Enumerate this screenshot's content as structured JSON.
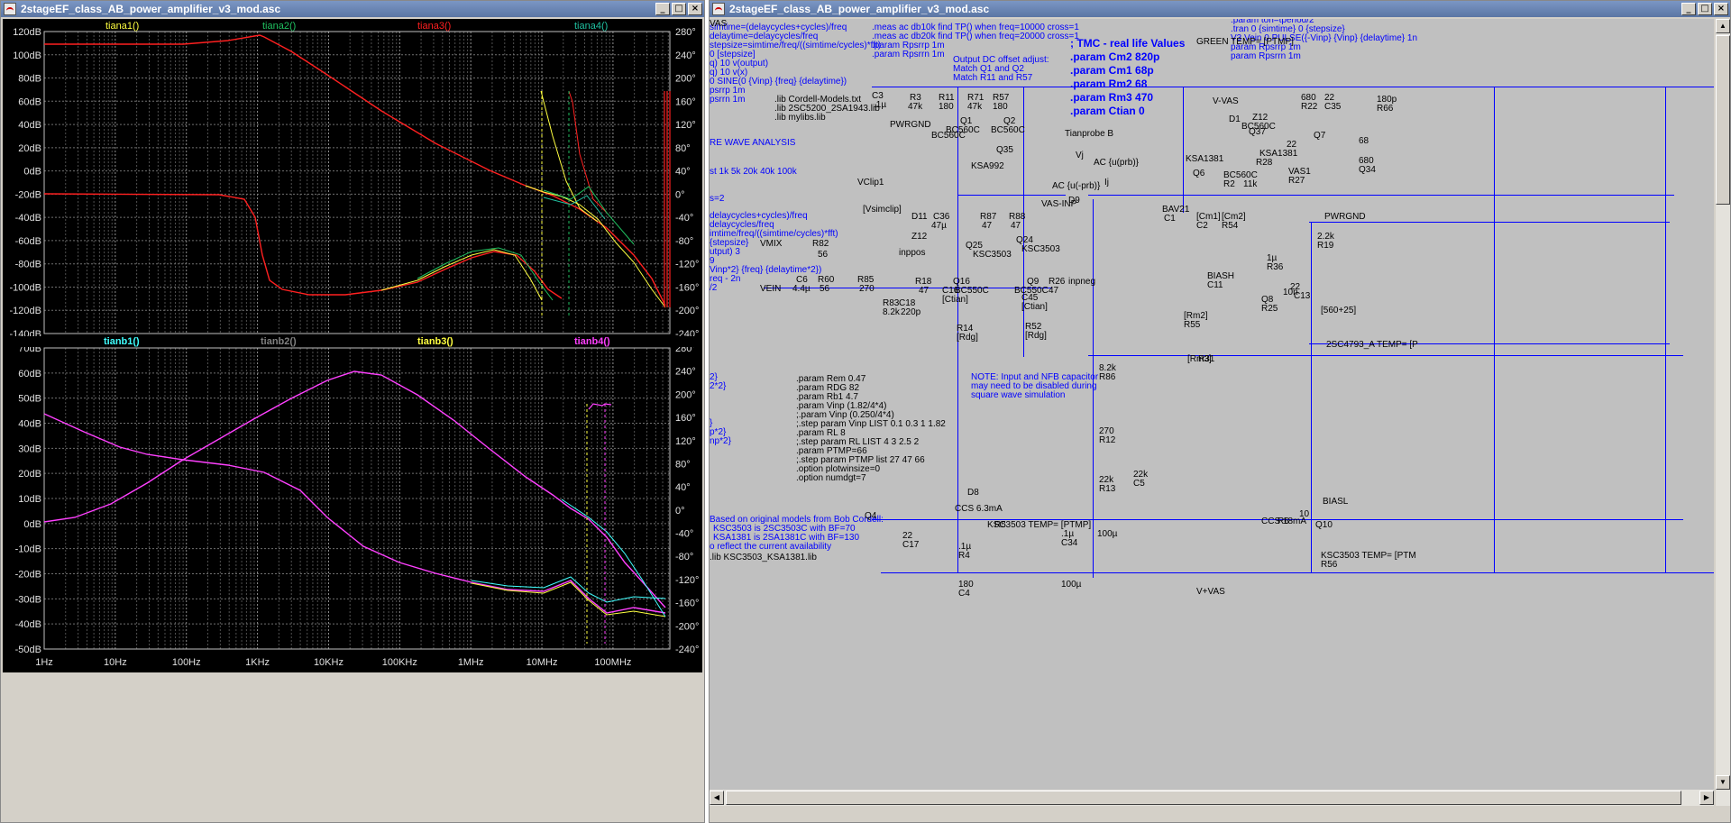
{
  "colors": {
    "grid": "#808080",
    "axis": "#cccccc",
    "red": "#ff2020",
    "magenta": "#ff40ff",
    "cyan": "#40ffff",
    "yellow": "#ffff40",
    "green": "#20c060",
    "wire": "#0000ff"
  },
  "left_window": {
    "title": "2stageEF_class_AB_power_amplifier_v3_mod.asc",
    "top_pane": {
      "traces": [
        {
          "name": "tiana1()",
          "color": "#ffff40"
        },
        {
          "name": "tiana2()",
          "color": "#20c060"
        },
        {
          "name": "tiana3()",
          "color": "#ff2020"
        },
        {
          "name": "tiana4()",
          "color": "#20c0a0"
        }
      ],
      "left_ticks": [
        "120dB",
        "100dB",
        "80dB",
        "60dB",
        "40dB",
        "20dB",
        "0dB",
        "-20dB",
        "-40dB",
        "-60dB",
        "-80dB",
        "-100dB",
        "-120dB",
        "-140dB"
      ],
      "right_ticks": [
        "280°",
        "240°",
        "200°",
        "160°",
        "120°",
        "80°",
        "40°",
        "0°",
        "-40°",
        "-80°",
        "-120°",
        "-160°",
        "-200°",
        "-240°"
      ]
    },
    "bottom_pane": {
      "traces": [
        {
          "name": "tianb1()",
          "color": "#40ffff"
        },
        {
          "name": "tianb2()",
          "color": "#808080"
        },
        {
          "name": "tianb3()",
          "color": "#ffff40"
        },
        {
          "name": "tianb4()",
          "color": "#ff40ff"
        }
      ],
      "left_ticks": [
        "70dB",
        "60dB",
        "50dB",
        "40dB",
        "30dB",
        "20dB",
        "10dB",
        "0dB",
        "-10dB",
        "-20dB",
        "-30dB",
        "-40dB",
        "-50dB"
      ],
      "right_ticks": [
        "280°",
        "240°",
        "200°",
        "160°",
        "120°",
        "80°",
        "40°",
        "0°",
        "-40°",
        "-80°",
        "-120°",
        "-160°",
        "-200°",
        "-240°"
      ]
    },
    "x_ticks": [
      "1Hz",
      "10Hz",
      "100Hz",
      "1KHz",
      "10KHz",
      "100KHz",
      "1MHz",
      "10MHz",
      "100MHz"
    ]
  },
  "right_window": {
    "title": "2stageEF_class_AB_power_amplifier_v3_mod.asc",
    "directives": [
      ".meas ac db10k find TP() when freq=10000 cross=1",
      ".meas ac db20k find TP() when freq=20000 cross=1",
      ".param Rpsrrp 1m",
      ".param Rpsrrn 1m"
    ],
    "left_cut_lines": [
      "simtime=(delaycycles+cycles)/freq",
      "delaytime=delaycycles/freq",
      "stepsize=simtime/freq/((simtime/cycles)*fft)",
      "0 [stepsize]",
      "q) 10 v(output)",
      "q) 10 v(x)",
      "0 SINE(0 {Vinp} {freq} {delaytime})",
      "psrrp 1m",
      "psrrn 1m"
    ],
    "sq_wave": "RE WAVE ANALYSIS",
    "st_line": "st 1k 5k 20k 40k 100k",
    "s2": "s=2",
    "left_cut2": [
      "delaycycles+cycles)/freq",
      "delaycycles/freq",
      "imtime/freq/((simtime/cycles)*fft)",
      "{stepsize}",
      "utput) 3",
      "9",
      "Vinp*2} {freq} {delaytime*2})",
      "req - 2n",
      "/2"
    ],
    "left_cut3": [
      "2}",
      "2*2}",
      "}",
      "p*2}",
      "np*2}"
    ],
    "offset_note": [
      "Output DC offset adjust:",
      "Match Q1 and Q2",
      "Match R11 and R57"
    ],
    "libs": [
      ".lib Cordell-Models.txt",
      ".lib 2SC5200_2SA1943.lib",
      ".lib mylibs.lib"
    ],
    "tmc_title": "; TMC - real life Values",
    "tmc_params": [
      ".param Cm2 820p",
      ".param Cm1 68p",
      ".param Rm2 68",
      ".param Rm3 470",
      ".param Ctian 0"
    ],
    "top_right_cmds": [
      ".param ton=tperiod/2",
      ".tran 0 {simtime} 0 {stepsize}",
      "V3 Vein 0 PULSE({-Vinp} {Vinp} {delaytime} 1n",
      "param Rpsrrp 1m",
      "param Rpsrrn 1m"
    ],
    "params_block": [
      ".param Rem 0.47",
      ".param RDG 82",
      ".param Rb1 4.7",
      ".param Vinp (1.82/4*4)",
      ";.param Vinp (0.250/4*4)",
      ";.step param Vinp LIST 0.1 0.3 1 1.82",
      ".param RL 8",
      ";.step param RL LIST 4 3 2.5 2",
      ".param PTMP=66",
      ";.step param PTMP list 27 47 66",
      ".option plotwinsize=0",
      ".option numdgt=7"
    ],
    "nfb_note": [
      "NOTE: Input and NFB capacitor",
      "may need to be disabled during",
      "square wave simulation"
    ],
    "cordell_note": [
      "Based on original models from Bob Cordell:",
      "KSC3503 is 2SC3503C with BF=70",
      "KSA1381 is 2SA1381C with BF=130",
      "o reflect the current availability",
      ".lib KSC3503_KSA1381.lib"
    ],
    "component_labels": [
      "C3",
      ".1µ",
      "R3",
      "47k",
      "R11",
      "180",
      "R71",
      "47k",
      "R57",
      "180",
      "Q1",
      "BC560C",
      "Q2",
      "BC560C",
      "BC560C",
      "Q35",
      "KSA992",
      "PWRGND",
      "VClip1",
      "[Vsimclip]",
      "D11",
      "Z12",
      "C36",
      "47µ",
      "R87",
      "47",
      "R88",
      "47",
      "Q25",
      "KSC3503",
      "Q24",
      "KSC3503",
      "VMIX",
      "R82",
      "56",
      "VEIN",
      "C6",
      "4.4µ",
      "R60",
      "56",
      "R85",
      "270",
      "inppos",
      "R18",
      "47",
      "C16",
      "[Ctian]",
      "R83",
      "8.2k",
      "C18",
      "220p",
      "Q16",
      "BC550C",
      "Q9",
      "BC550C",
      "R26",
      "47",
      "inpneg",
      "C45",
      "[Ctian]",
      "R14",
      "[Rdg]",
      "R52",
      "[Rdg]",
      "Tianprobe B",
      "Vj",
      "AC {u(prb)}",
      "AC {u(-prb)}",
      "Ij",
      "VAS-INP",
      "D9",
      "BAV21",
      "C1",
      "[Cm1]",
      "C2",
      "[Cm2]",
      "R54",
      "[Rm2]",
      "R55",
      "[Rm3]",
      "R31",
      "8.2k",
      "R86",
      "270",
      "R12",
      "22k",
      "R13",
      "22k",
      "C5",
      "100µ",
      "D8",
      "CCS 6.3mA",
      "Q4",
      "KSC3503 TEMP= [PTMP]",
      "R5",
      "22",
      "C17",
      ".1µ",
      "R4",
      "180",
      "C4",
      ".1µ",
      "C34",
      "100µ",
      "GREEN TEMP= [PTMP]",
      "V+VAS",
      "V-VAS",
      "D1",
      "Z12",
      "BC560C",
      "Q37",
      "KSA1381",
      "R28",
      "680",
      "R22",
      "22",
      "C35",
      "180p",
      "R66",
      "22",
      "Q7",
      "VAS1",
      "R27",
      "680",
      "Q34",
      "KSA1381",
      "Q6",
      "BC560C",
      "R2",
      "11k",
      "PWRGND",
      "BIASH",
      "C11",
      "1µ",
      "R36",
      "2.2k",
      "R19",
      "22",
      "C13",
      "10n",
      "Q8",
      "R25",
      "[560+25]",
      "2SC4793_A TEMP= [P",
      "BIASL",
      "CCS 18mA",
      "R6",
      "10",
      "Q10",
      "KSC3503 TEMP= [PTM",
      "R56",
      "68",
      "VAS"
    ]
  }
}
